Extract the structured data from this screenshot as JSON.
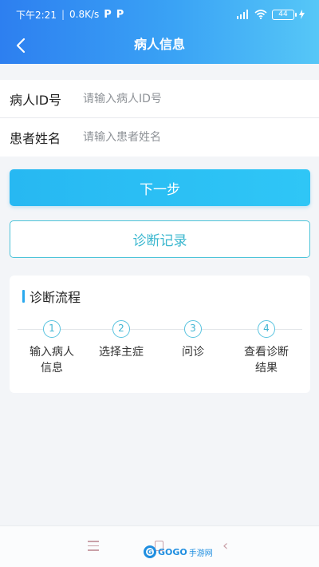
{
  "status_bar": {
    "time": "下午2:21",
    "speed": "0.8K/s",
    "app_badges": [
      "P",
      "P"
    ],
    "battery": "44"
  },
  "header": {
    "title": "病人信息"
  },
  "form": {
    "patient_id": {
      "label": "病人ID号",
      "placeholder": "请输入病人ID号",
      "value": ""
    },
    "patient_name": {
      "label": "患者姓名",
      "placeholder": "请输入患者姓名",
      "value": ""
    }
  },
  "buttons": {
    "next": "下一步",
    "records": "诊断记录"
  },
  "flow": {
    "title": "诊断流程",
    "steps": [
      {
        "num": "1",
        "label": "输入病人\n信息"
      },
      {
        "num": "2",
        "label": "选择主症"
      },
      {
        "num": "3",
        "label": "问诊"
      },
      {
        "num": "4",
        "label": "查看诊断\n结果"
      }
    ]
  },
  "watermark": {
    "brand": "GOGO",
    "suffix": "手游网"
  },
  "colors": {
    "header_start": "#2d7ff0",
    "header_end": "#56c7f7",
    "primary_button": "#2fc6f6",
    "outline_accent": "#4cc3d8"
  }
}
